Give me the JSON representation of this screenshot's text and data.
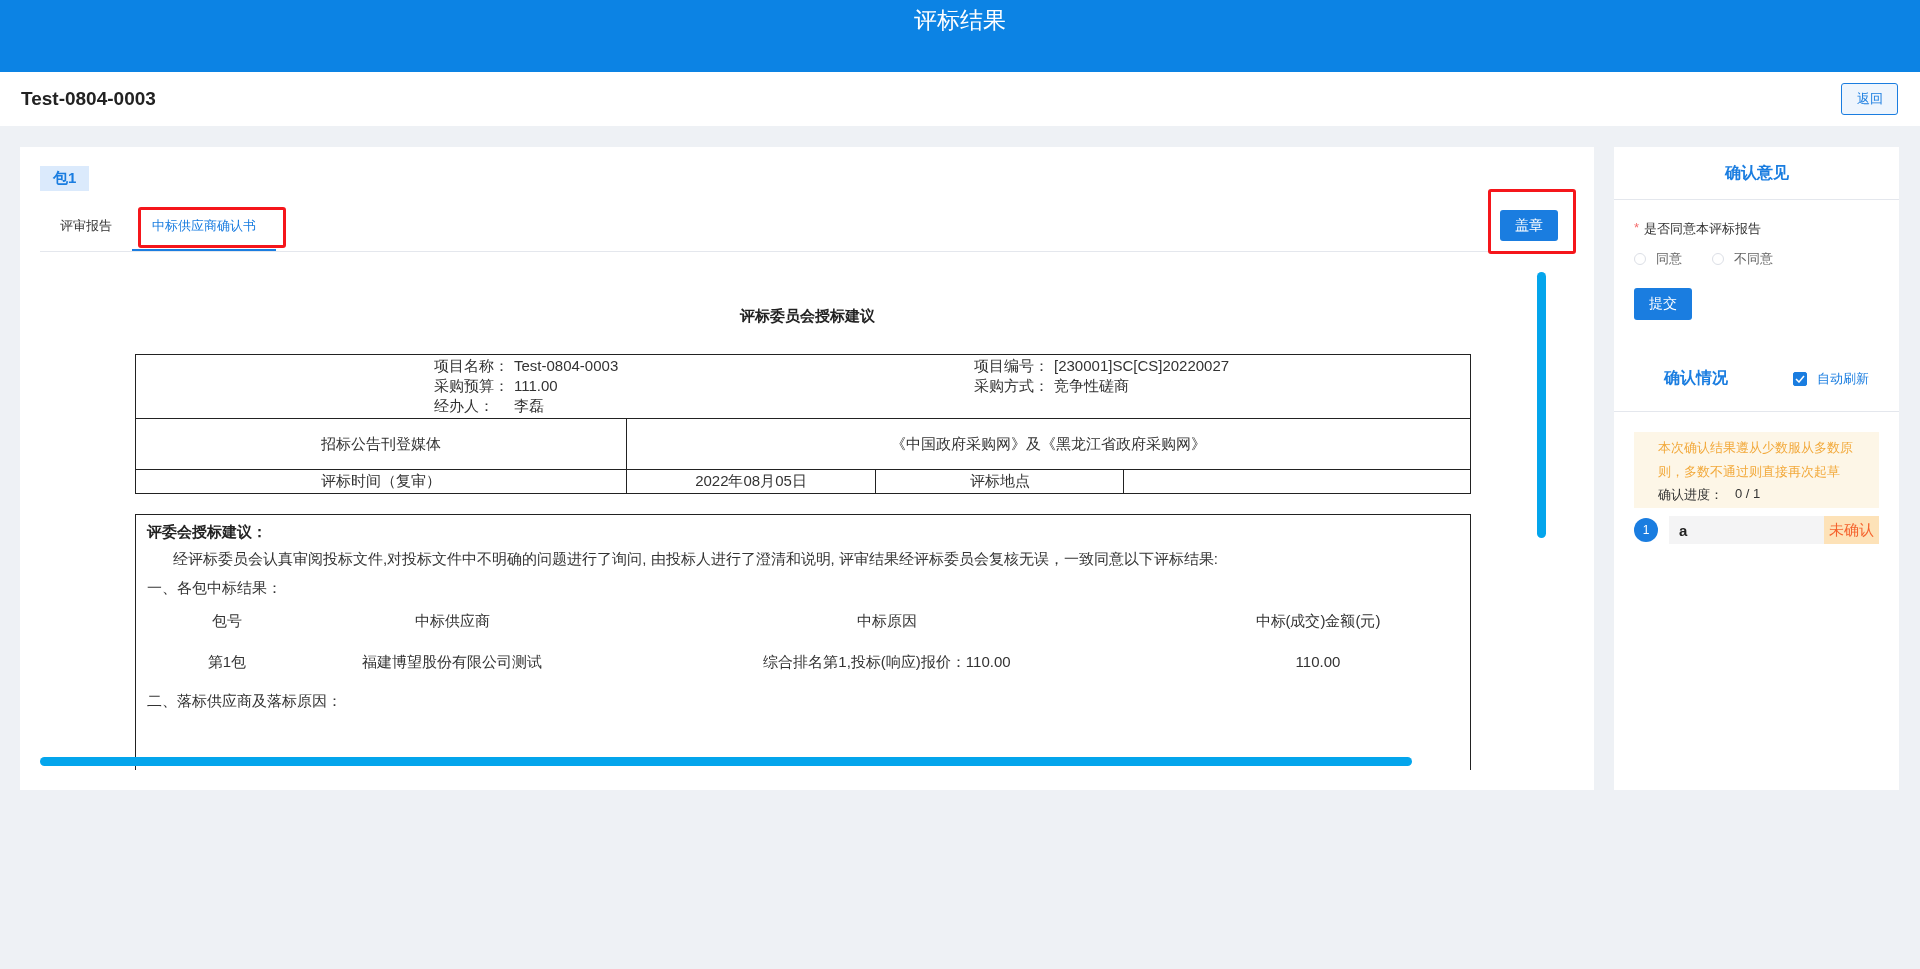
{
  "header": {
    "title": "评标结果"
  },
  "project": {
    "title": "Test-0804-0003",
    "back_button": "返回"
  },
  "package_tag": "包1",
  "tabs": [
    {
      "label": "评审报告",
      "selected": false,
      "highlighted": false
    },
    {
      "label": "中标供应商确认书",
      "selected": true,
      "highlighted": true
    }
  ],
  "stamp_button": {
    "label": "盖章",
    "highlighted": true
  },
  "document": {
    "title": "评标委员会授标建议",
    "info": [
      {
        "label": "项目名称：",
        "value": "Test-0804-0003"
      },
      {
        "label": "项目编号：",
        "value": "[230001]SC[CS]20220027"
      },
      {
        "label": "采购预算：",
        "value": "111.00"
      },
      {
        "label": "采购方式：",
        "value": "竞争性磋商"
      },
      {
        "label": "经办人：",
        "value": "李磊"
      }
    ],
    "media_label": "招标公告刊登媒体",
    "media_value": "《中国政府采购网》及《黑龙江省政府采购网》",
    "time_label": "评标时间（复审）",
    "time_value": "2022年08月05日",
    "place_label": "评标地点",
    "heading": "评委会授标建议：",
    "paragraph": "经评标委员会认真审阅投标文件,对投标文件中不明确的问题进行了询问, 由投标人进行了澄清和说明, 评审结果经评标委员会复核无误，一致同意以下评标结果:",
    "section_1": "一、各包中标结果：",
    "columns": [
      "包号",
      "中标供应商",
      "中标原因",
      "中标(成交)金额(元)"
    ],
    "rows": [
      [
        "第1包",
        "福建博望股份有限公司测试",
        "综合排名第1,投标(响应)报价：110.00",
        "110.00"
      ]
    ],
    "section_2": "二、落标供应商及落标原因："
  },
  "confirm_panel": {
    "title": "确认意见",
    "required_mark": "*",
    "question": "是否同意本评标报告",
    "options": [
      {
        "label": "同意",
        "selected": false
      },
      {
        "label": "不同意",
        "selected": false
      }
    ],
    "submit": "提交",
    "status_title": "确认情况",
    "auto_refresh": {
      "label": "自动刷新",
      "checked": true
    },
    "notice": "本次确认结果遵从少数服从多数原则，多数不通过则直接再次起草",
    "progress_label": "确认进度：",
    "progress_value": "0 / 1",
    "members": [
      {
        "index": "1",
        "name": "a",
        "status": "未确认",
        "confirmed": false
      }
    ]
  }
}
